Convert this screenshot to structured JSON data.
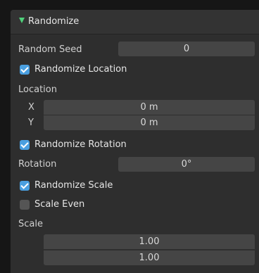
{
  "panel": {
    "title": "Randomize"
  },
  "random_seed": {
    "label": "Random Seed",
    "value": "0"
  },
  "randomize_location": {
    "label": "Randomize Location",
    "checked": true
  },
  "location": {
    "label": "Location",
    "x_label": "X",
    "x_value": "0 m",
    "y_label": "Y",
    "y_value": "0 m"
  },
  "randomize_rotation": {
    "label": "Randomize Rotation",
    "checked": true
  },
  "rotation": {
    "label": "Rotation",
    "value": "0°"
  },
  "randomize_scale": {
    "label": "Randomize Scale",
    "checked": true
  },
  "scale_even": {
    "label": "Scale Even",
    "checked": false
  },
  "scale": {
    "label": "Scale",
    "value_1": "1.00",
    "value_2": "1.00"
  },
  "colors": {
    "checkbox_on": "#4a9fe0",
    "expand_arrow": "#4fd07a"
  }
}
